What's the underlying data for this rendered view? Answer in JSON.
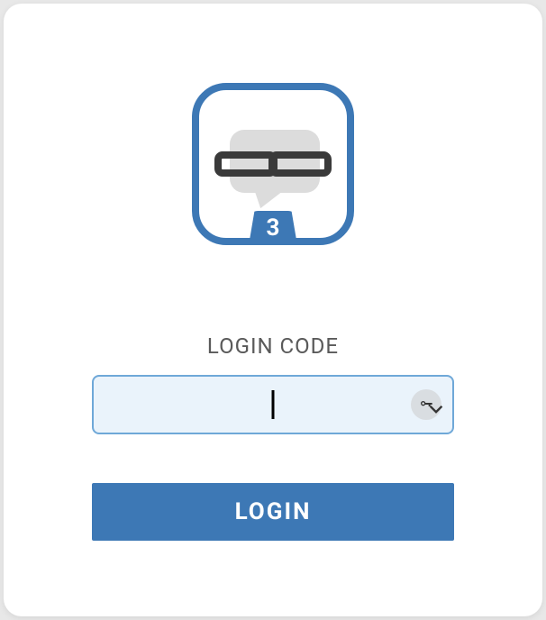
{
  "logo": {
    "badge_text": "3",
    "icon_name": "chain-link-chat-icon"
  },
  "form": {
    "label": "LOGIN CODE",
    "input_value": "",
    "input_placeholder": "",
    "key_button_name": "password-key-icon"
  },
  "actions": {
    "login_label": "LOGIN"
  },
  "colors": {
    "accent": "#3d78b5",
    "input_bg": "#eaf3fb",
    "input_border": "#8db8dd"
  }
}
